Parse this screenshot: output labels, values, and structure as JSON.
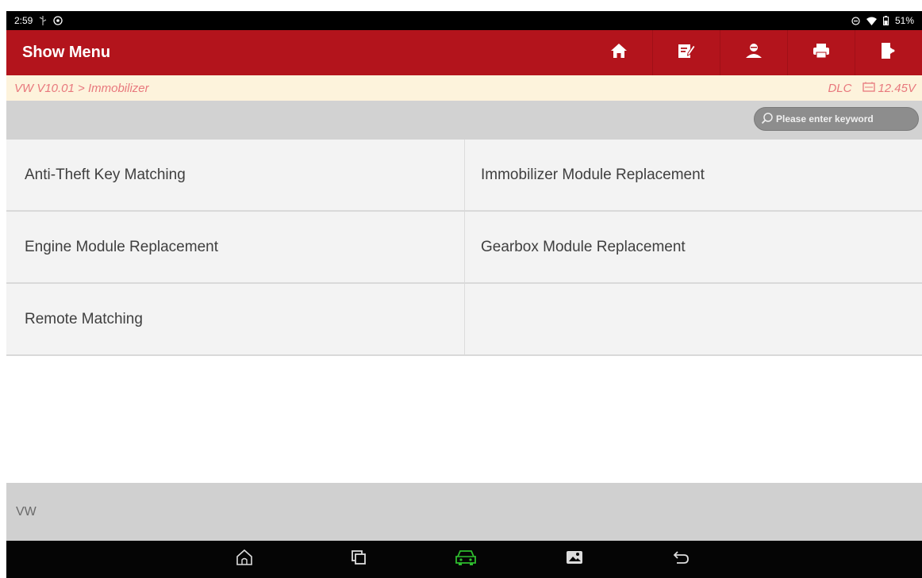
{
  "status_bar": {
    "time": "2:59",
    "battery": "51%"
  },
  "header": {
    "title": "Show Menu",
    "tools": [
      {
        "name": "home-icon"
      },
      {
        "name": "edit-report-icon"
      },
      {
        "name": "user-icon"
      },
      {
        "name": "print-icon"
      },
      {
        "name": "exit-icon"
      }
    ]
  },
  "breadcrumb": {
    "path": "VW V10.01 > Immobilizer",
    "dlc": "DLC",
    "voltage": "12.45V"
  },
  "search": {
    "placeholder": "Please enter keyword"
  },
  "menu": {
    "items": [
      "Anti-Theft Key Matching",
      "Immobilizer Module Replacement",
      "Engine Module Replacement",
      "Gearbox Module Replacement",
      "Remote Matching",
      ""
    ]
  },
  "footer": {
    "label": "VW"
  },
  "colors": {
    "header_bg": "#b3141c",
    "breadcrumb_text": "#e8787d",
    "breadcrumb_bg": "#fdf3dc",
    "car_icon": "#2ebd2e"
  }
}
